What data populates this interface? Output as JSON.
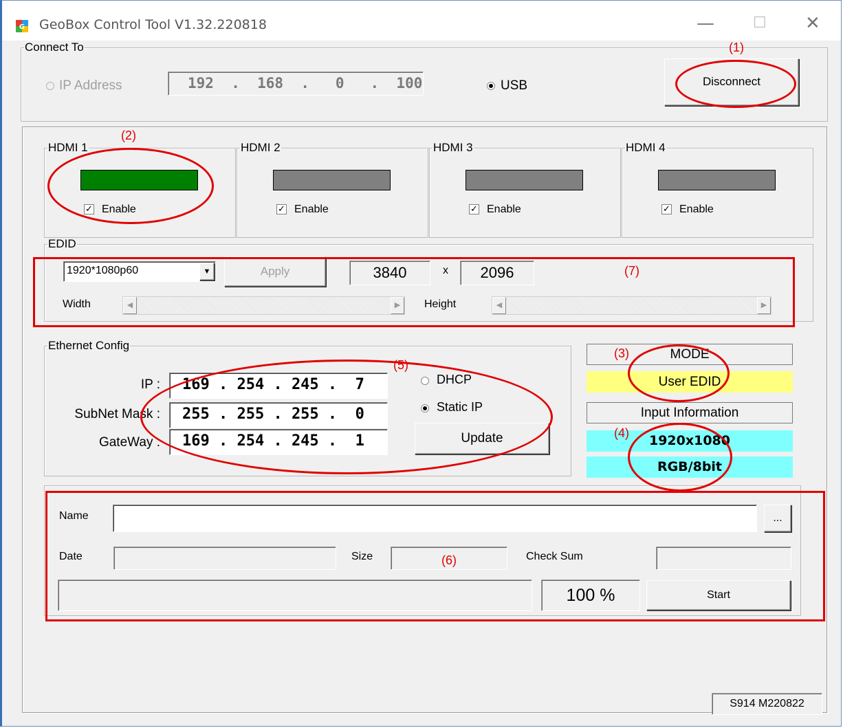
{
  "window": {
    "title": "GeoBox Control Tool  V1.32.220818",
    "controls": {
      "minimize": "—",
      "maximize": "☐",
      "close": "✕"
    }
  },
  "connect": {
    "legend": "Connect To",
    "ip_label": "IP Address",
    "ip_value": "192  .  168  .   0   .  100",
    "usb_label": "USB",
    "selected": "USB",
    "disconnect_label": "Disconnect"
  },
  "hdmi": [
    {
      "label": "HDMI 1",
      "enable_label": "Enable",
      "enabled": true,
      "status_color": "#008000"
    },
    {
      "label": "HDMI 2",
      "enable_label": "Enable",
      "enabled": true,
      "status_color": "#808080"
    },
    {
      "label": "HDMI 3",
      "enable_label": "Enable",
      "enabled": true,
      "status_color": "#808080"
    },
    {
      "label": "HDMI 4",
      "enable_label": "Enable",
      "enabled": true,
      "status_color": "#808080"
    }
  ],
  "edid": {
    "legend": "EDID",
    "resolution_selected": "1920*1080p60",
    "apply_label": "Apply",
    "width_value": "3840",
    "x_label": "x",
    "height_value": "2096",
    "width_label": "Width",
    "height_label": "Height"
  },
  "ethernet": {
    "legend": "Ethernet Config",
    "ip_label": "IP :",
    "ip_value": "169 . 254 . 245 .  7",
    "subnet_label": "SubNet Mask :",
    "subnet_value": "255 . 255 . 255 .  0",
    "gateway_label": "GateWay :",
    "gateway_value": "169 . 254 . 245 .  1",
    "dhcp_label": "DHCP",
    "static_label": "Static IP",
    "selected": "Static IP",
    "update_label": "Update"
  },
  "status": {
    "mode_header": "MODE",
    "mode_value": "User EDID",
    "input_header": "Input Information",
    "input_resolution": "1920x1080",
    "input_format": "RGB/8bit",
    "mode_color": "#ffff80",
    "input_color": "#80ffff"
  },
  "firmware": {
    "name_label": "Name",
    "name_value": "",
    "browse_label": "...",
    "date_label": "Date",
    "size_label": "Size",
    "checksum_label": "Check Sum",
    "progress_text": "100 %",
    "progress_fraction": 0,
    "start_label": "Start"
  },
  "version": "S914 M220822",
  "annotations": [
    "(1)",
    "(2)",
    "(3)",
    "(4)",
    "(5)",
    "(6)",
    "(7)"
  ],
  "annotation_color": "#e00000"
}
